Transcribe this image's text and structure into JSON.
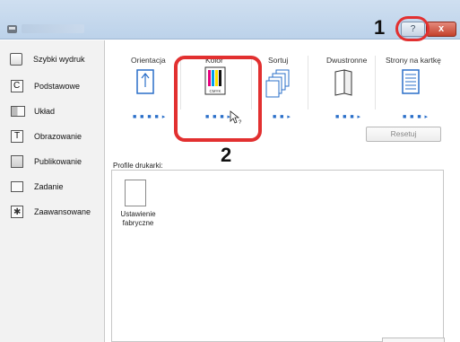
{
  "window": {
    "title_bar_buttons": {
      "help": "?",
      "close": "x"
    }
  },
  "sidebar": {
    "items": [
      {
        "label": "Szybki wydruk",
        "icon": "quick-print-icon",
        "active": true
      },
      {
        "label": "Podstawowe",
        "icon": "basic-icon"
      },
      {
        "label": "Układ",
        "icon": "layout-icon"
      },
      {
        "label": "Obrazowanie",
        "icon": "imaging-icon"
      },
      {
        "label": "Publikowanie",
        "icon": "publishing-icon"
      },
      {
        "label": "Zadanie",
        "icon": "job-icon"
      },
      {
        "label": "Zaawansowane",
        "icon": "advanced-icon"
      }
    ]
  },
  "features": {
    "tabs": [
      "Orientacja",
      "Kolor",
      "Sortuj",
      "Dwustronne",
      "Strony na kartkę"
    ],
    "color_icon_text": "CMYK"
  },
  "reset_label": "Resetuj",
  "profiles": {
    "section_label": "Profile drukarki:",
    "items": [
      {
        "label": "Ustawienie fabryczne"
      }
    ]
  },
  "annotations": {
    "callout_1": "1",
    "callout_2": "2"
  },
  "colors": {
    "accent": "#2a6fc9",
    "callout": "#e23030",
    "close": "#c4412c"
  }
}
